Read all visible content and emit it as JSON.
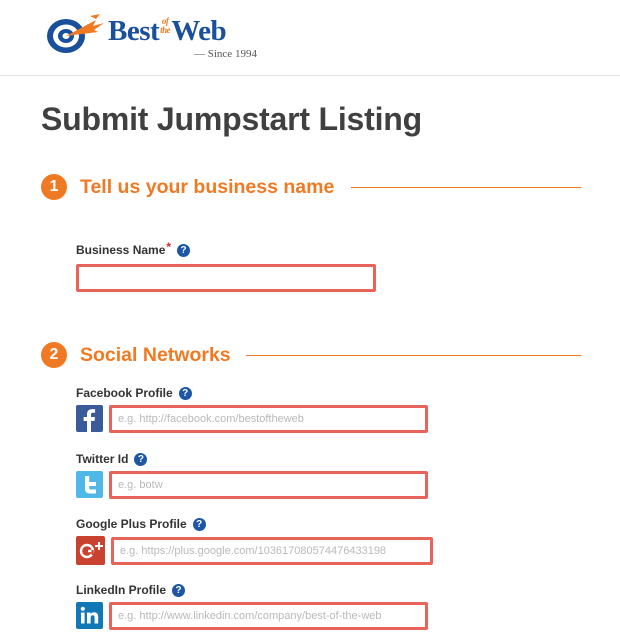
{
  "logo": {
    "word_best": "Best",
    "small_of": "of",
    "small_the": "the",
    "word_web": "Web",
    "since": "— Since 1994"
  },
  "page": {
    "title": "Submit Jumpstart Listing"
  },
  "sections": [
    {
      "number": "1",
      "title": "Tell us your business name"
    },
    {
      "number": "2",
      "title": "Social Networks"
    }
  ],
  "fields": {
    "business_name": {
      "label": "Business Name",
      "required_mark": "*",
      "value": "",
      "placeholder": ""
    },
    "facebook": {
      "label": "Facebook Profile",
      "placeholder": "e.g. http://facebook.com/bestoftheweb",
      "value": ""
    },
    "twitter": {
      "label": "Twitter Id",
      "placeholder": "e.g. botw",
      "value": ""
    },
    "googleplus": {
      "label": "Google Plus Profile",
      "placeholder": "e.g. https://plus.google.com/103617080574476433198",
      "value": ""
    },
    "linkedin": {
      "label": "LinkedIn Profile",
      "placeholder": "e.g. http://www.linkedin.com/company/best-of-the-web",
      "value": ""
    }
  },
  "help_glyph": "?",
  "icons": {
    "facebook": "facebook-icon",
    "twitter": "twitter-icon",
    "googleplus": "google-plus-icon",
    "linkedin": "linkedin-icon"
  },
  "colors": {
    "accent_orange": "#f07a23",
    "brand_blue": "#1a4f9c",
    "input_border": "#e8645a",
    "required_red": "#d8262d"
  }
}
